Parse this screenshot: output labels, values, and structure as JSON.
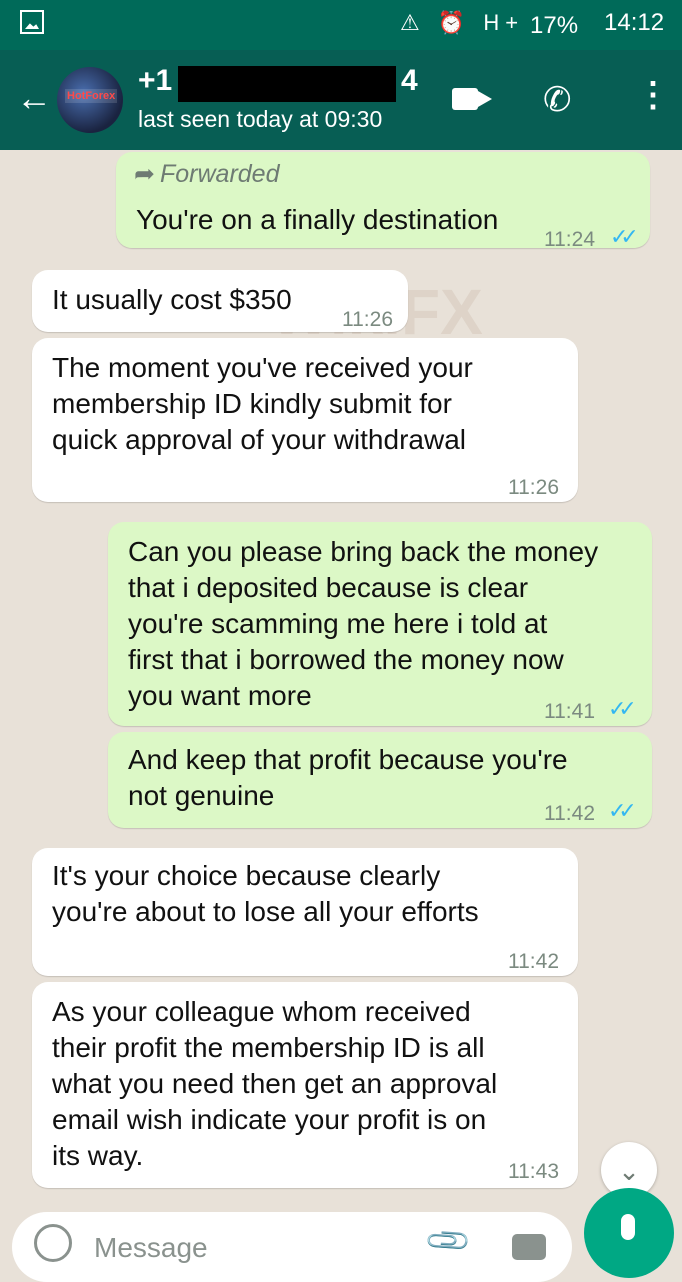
{
  "status_bar": {
    "time": "14:12",
    "battery": "17%",
    "icons_text": "⚠ ⏰ H+"
  },
  "header": {
    "back_icon": "arrow-left",
    "avatar_text": "HotForex",
    "contact_prefix": "+1",
    "contact_suffix": "4",
    "last_seen": "last seen today at 09:30"
  },
  "messages": [
    {
      "dir": "out",
      "forwarded": "Forwarded",
      "text": "You're on a finally destination",
      "time": "11:24"
    },
    {
      "dir": "in",
      "text": "It usually cost $350",
      "time": "11:26"
    },
    {
      "dir": "in",
      "text": "The moment you've received your\nmembership ID kindly submit for\nquick approval of your withdrawal",
      "time": "11:26"
    },
    {
      "dir": "out",
      "text": "Can you please bring back the money\nthat i deposited because is clear\nyou're scamming me here i told at\nfirst that i borrowed the money now\nyou want more",
      "time": "11:41"
    },
    {
      "dir": "out",
      "text": "And keep that profit because you're\nnot genuine",
      "time": "11:42"
    },
    {
      "dir": "in",
      "text": "It's your choice because clearly\nyou're about to lose all your efforts",
      "time": "11:42"
    },
    {
      "dir": "in",
      "text": "As your colleague whom received\ntheir profit the membership ID is all\nwhat you need then get an approval\nemail wish indicate your profit is on\nits way.",
      "time": "11:43"
    }
  ],
  "watermark": "WikiFX",
  "composer": {
    "placeholder": "Message"
  },
  "colors": {
    "header": "#075e54",
    "status_bar": "#006a59",
    "outgoing": "#dcf8c6",
    "incoming": "#ffffff",
    "read_ticks": "#34b7f1",
    "mic": "#00a884"
  }
}
